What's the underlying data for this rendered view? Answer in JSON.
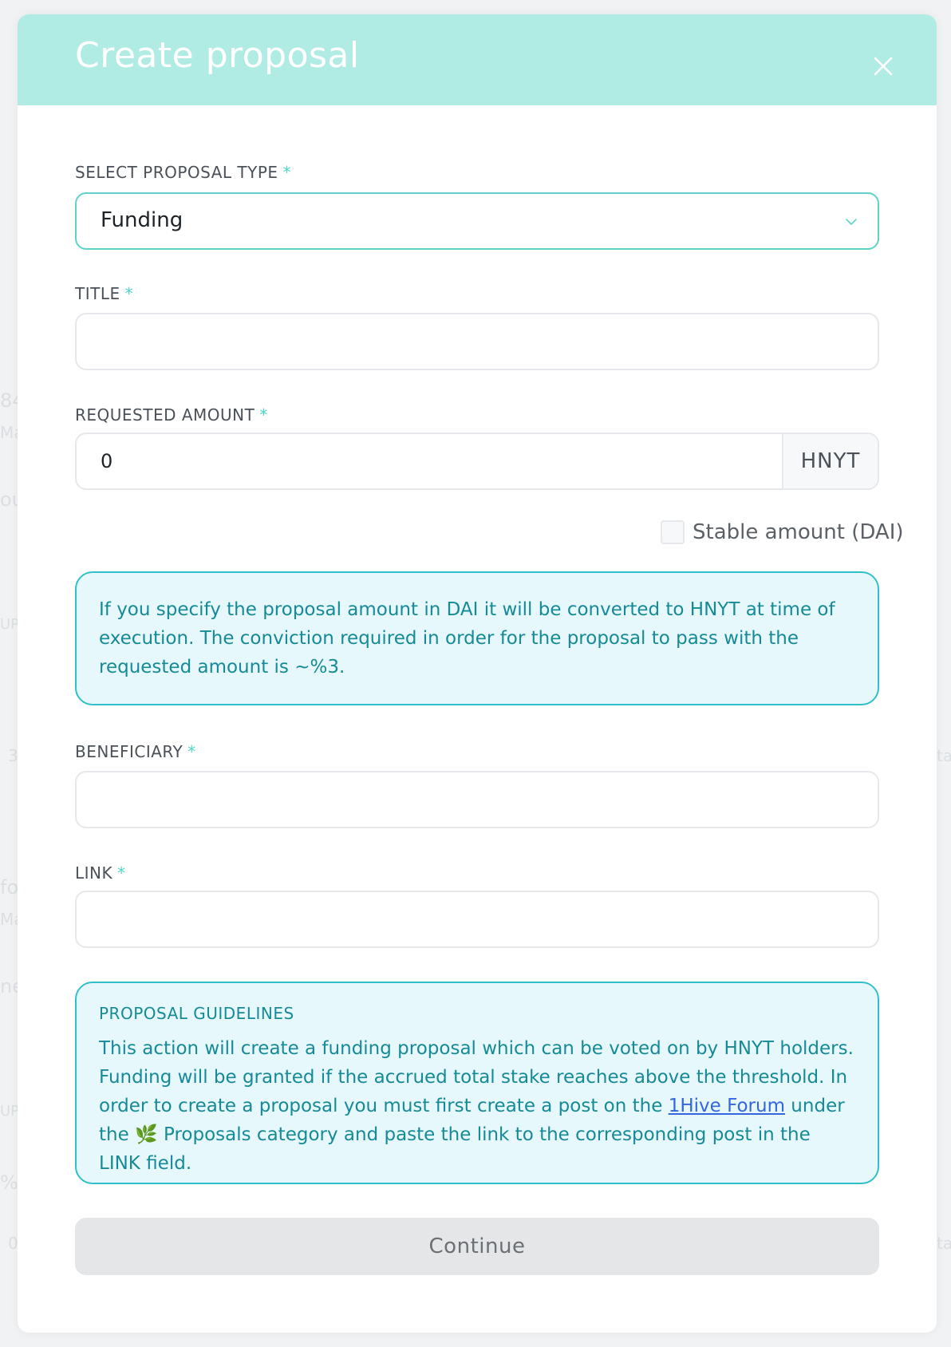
{
  "background_fragments": [
    "84",
    "Ma",
    "ou",
    "UP",
    "3",
    "ta",
    "fo",
    "Ma",
    "ne",
    "UP",
    "%",
    "0",
    "ta"
  ],
  "modal": {
    "title": "Create proposal",
    "close_icon": "close-icon"
  },
  "form": {
    "proposal_type": {
      "label": "SELECT PROPOSAL TYPE",
      "required_mark": "*",
      "selected": "Funding",
      "icon": "chevron-down-icon"
    },
    "title": {
      "label": "TITLE",
      "required_mark": "*",
      "value": "",
      "placeholder": ""
    },
    "requested_amount": {
      "label": "REQUESTED AMOUNT",
      "required_mark": "*",
      "value": "0",
      "unit": "HNYT",
      "stable_checkbox_label": "Stable amount (DAI)",
      "stable_checked": false
    },
    "amount_info": "If you specify the proposal amount in DAI it will be converted to HNYT at time of execution. The conviction required in order for the proposal to pass with the requested amount is ~%3.",
    "beneficiary": {
      "label": "BENEFICIARY",
      "required_mark": "*",
      "value": "",
      "placeholder": ""
    },
    "link": {
      "label": "LINK",
      "required_mark": "*",
      "value": "",
      "placeholder": ""
    },
    "guidelines": {
      "title": "PROPOSAL GUIDELINES",
      "text_before_link": "This action will create a funding proposal which can be voted on by HNYT holders. Funding will be granted if the accrued total stake reaches above the threshold. In order to create a proposal you must first create a post on the ",
      "link_text": "1Hive Forum",
      "text_after_link": " under the ",
      "category_emoji": "🌿",
      "text_end": " Proposals category and paste the link to the corresponding post in the LINK field."
    },
    "continue_label": "Continue"
  },
  "colors": {
    "header_bg": "#b1ece4",
    "accent": "#4fd6c6",
    "info_border": "#2fc0cc",
    "info_bg": "#e6f8fc",
    "info_text": "#168a96",
    "link": "#3366e0",
    "button_disabled_bg": "#e5e6e7"
  }
}
